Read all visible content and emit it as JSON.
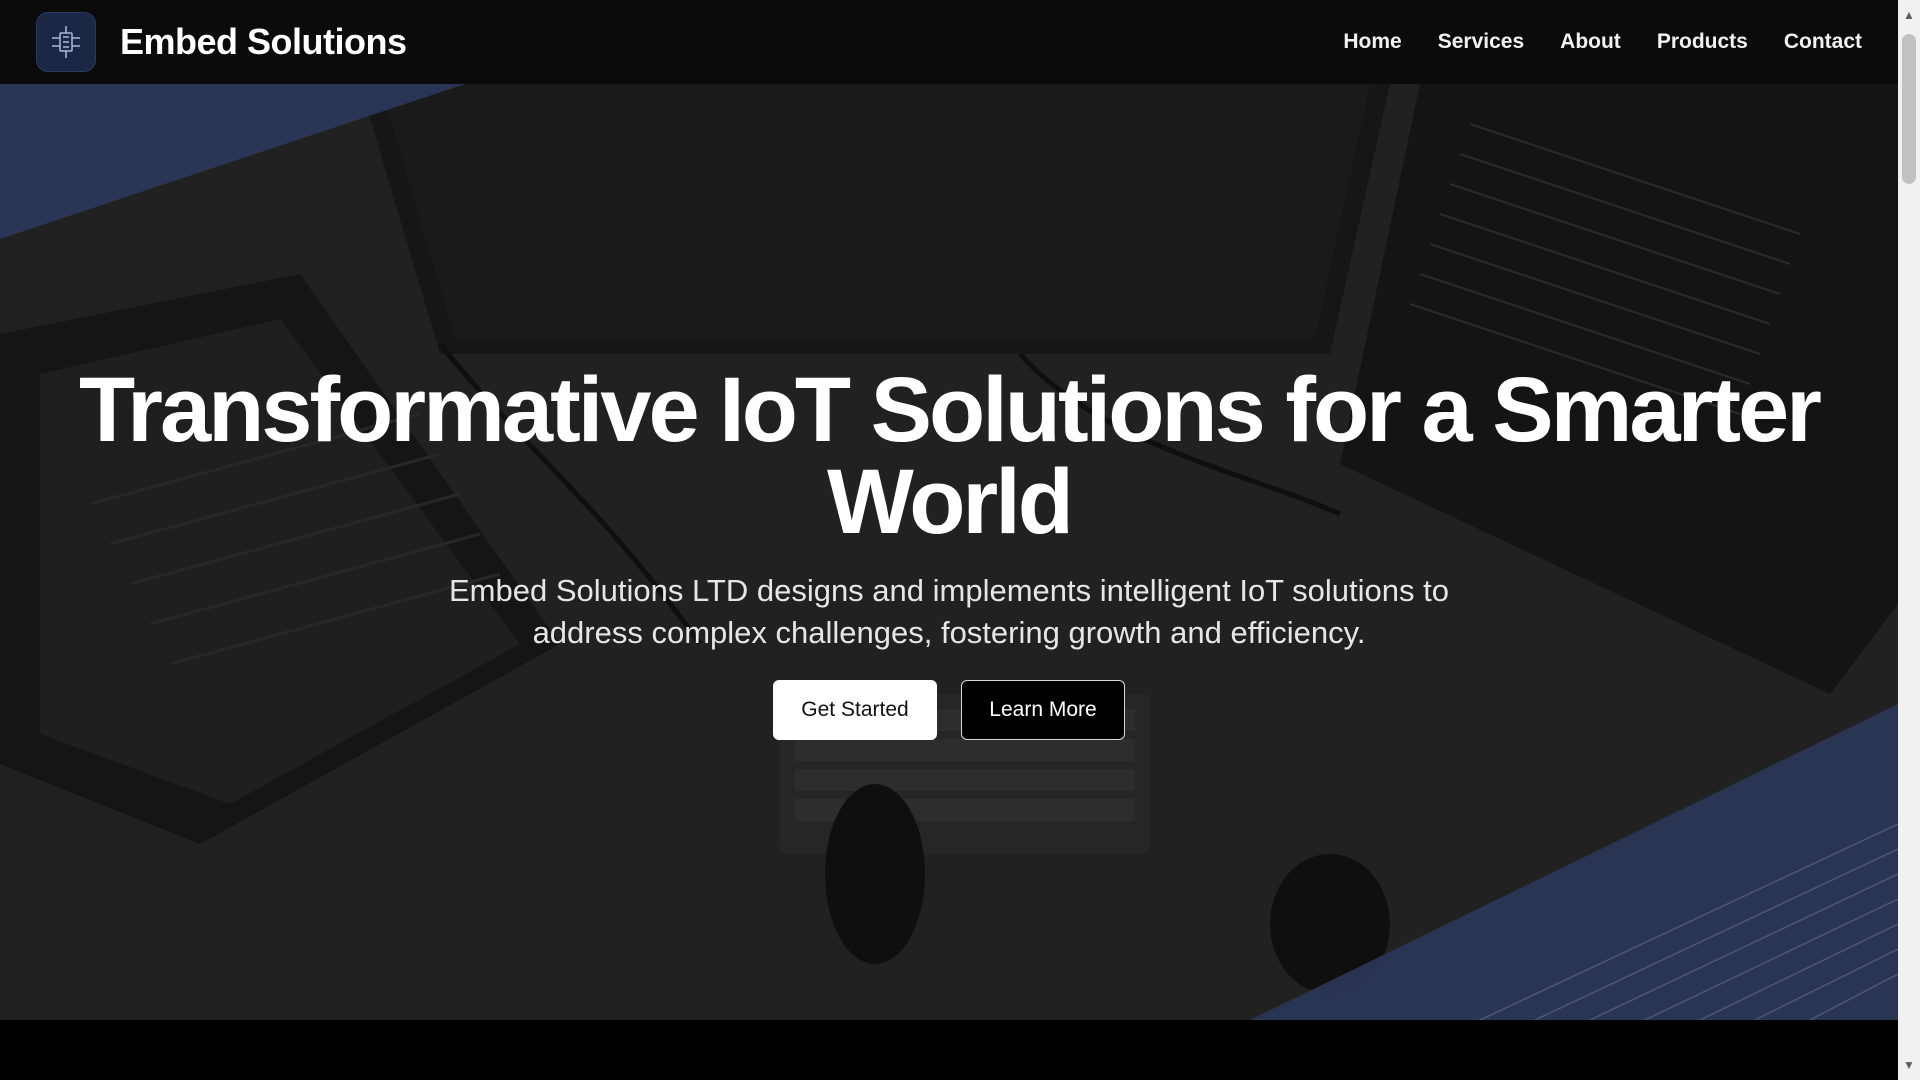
{
  "brand": {
    "name": "Embed Solutions",
    "logo_icon": "circuit-chip-icon"
  },
  "nav": {
    "items": [
      "Home",
      "Services",
      "About",
      "Products",
      "Contact"
    ]
  },
  "hero": {
    "title": "Transformative IoT Solutions for a Smarter World",
    "subtitle": "Embed Solutions LTD designs and implements intelligent IoT solutions to address complex challenges, fostering growth and efficiency.",
    "primary_cta": "Get Started",
    "secondary_cta": "Learn More"
  },
  "colors": {
    "accent_blue": "#3b4a77",
    "navbar_bg": "#0b0b0b",
    "hero_bg": "#2d2d2d"
  }
}
